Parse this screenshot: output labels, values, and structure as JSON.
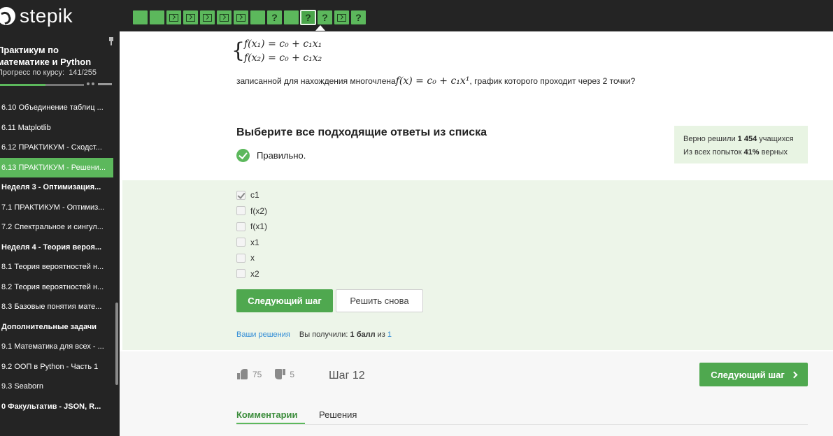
{
  "brand": {
    "name": "stepik"
  },
  "steps": [
    {
      "kind": "blank"
    },
    {
      "kind": "blank"
    },
    {
      "kind": "code"
    },
    {
      "kind": "code"
    },
    {
      "kind": "code"
    },
    {
      "kind": "code"
    },
    {
      "kind": "code"
    },
    {
      "kind": "blank"
    },
    {
      "kind": "quiz"
    },
    {
      "kind": "blank"
    },
    {
      "kind": "quiz",
      "active": true
    },
    {
      "kind": "quiz"
    },
    {
      "kind": "code"
    },
    {
      "kind": "quiz"
    }
  ],
  "sidebar": {
    "course_title": "Практикум по математике и Python",
    "progress_label": "Прогресс по курсу:",
    "progress_value": "141/255",
    "progress_fraction": 0.55,
    "items": [
      {
        "label": "6.10  Объединение таблиц ...",
        "type": "lesson"
      },
      {
        "label": "6.11  Matplotlib",
        "type": "lesson"
      },
      {
        "label": "6.12  ПРАКТИКУМ - Сходст...",
        "type": "lesson"
      },
      {
        "label": "6.13  ПРАКТИКУМ - Решени...",
        "type": "lesson",
        "active": true
      },
      {
        "label": "Неделя 3 - Оптимизация...",
        "type": "week"
      },
      {
        "label": "7.1  ПРАКТИКУМ - Оптимиз...",
        "type": "lesson"
      },
      {
        "label": "7.2  Спектральное и сингул...",
        "type": "lesson"
      },
      {
        "label": "Неделя 4 - Теория вероя...",
        "type": "week"
      },
      {
        "label": "8.1  Теория вероятностей н...",
        "type": "lesson"
      },
      {
        "label": "8.2  Теория вероятностей н...",
        "type": "lesson"
      },
      {
        "label": "8.3  Базовые понятия мате...",
        "type": "lesson"
      },
      {
        "label": "Дополнительные задачи",
        "type": "week"
      },
      {
        "label": "9.1  Математика для всех - ...",
        "type": "lesson"
      },
      {
        "label": "9.2  ООП в Python - Часть 1",
        "type": "lesson"
      },
      {
        "label": "9.3  Seaborn",
        "type": "lesson"
      },
      {
        "label": "0  Факультатив - JSON, R...",
        "type": "week"
      }
    ]
  },
  "problem": {
    "formula_line1": "f(x₁) = c₀ + c₁x₁",
    "formula_line2": "f(x₂) = c₀ + c₁x₂",
    "question_before": "записанной для нахождения многочлена",
    "question_math": "f(x) = c₀ + c₁x¹",
    "question_after": ", график которого проходит через 2 точки?",
    "choose_title": "Выберите все подходящие ответы из списка",
    "correct_text": "Правильно."
  },
  "stats": {
    "line1_prefix": "Верно решили",
    "solved_count": "1 454",
    "line1_suffix": "учащихся",
    "line2_prefix": "Из всех попыток",
    "percent": "41%",
    "line2_suffix": "верных"
  },
  "options": [
    {
      "label": "c1",
      "checked": true
    },
    {
      "label": "f(x2)",
      "checked": false
    },
    {
      "label": "f(x1)",
      "checked": false
    },
    {
      "label": "x1",
      "checked": false
    },
    {
      "label": "x",
      "checked": false
    },
    {
      "label": "x2",
      "checked": false
    }
  ],
  "actions": {
    "next_label": "Следующий шаг",
    "retry_label": "Решить снова",
    "your_solutions": "Ваши решения",
    "score_prefix": "Вы получили:",
    "score_value": "1 балл",
    "score_of": "из",
    "score_total": "1"
  },
  "footer": {
    "likes": "75",
    "dislikes": "5",
    "step_label": "Шаг 12",
    "next_step_label": "Следующий шаг",
    "tabs": [
      {
        "label": "Комментарии",
        "active": true
      },
      {
        "label": "Решения",
        "active": false
      }
    ]
  }
}
